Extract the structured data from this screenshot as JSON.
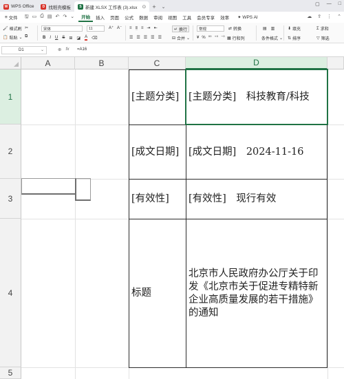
{
  "tabs": [
    {
      "label": "WPS Office",
      "logo": "W",
      "color": "#d8342a"
    },
    {
      "label": "找稻壳模板",
      "logo": "D",
      "color": "#d8342a"
    },
    {
      "label": "新建 XLSX 工作表 (3).xlsx",
      "logo": "S",
      "color": "#1f7244",
      "active": true
    }
  ],
  "menu": {
    "file": "文件",
    "items": [
      "开始",
      "插入",
      "页面",
      "公式",
      "数据",
      "审阅",
      "视图",
      "工具",
      "会员专享",
      "效率"
    ],
    "active": "开始",
    "ai": "WPS AI"
  },
  "ribbon": {
    "format_painter": "格式刷",
    "paste": "粘贴",
    "font_name": "宋体",
    "font_size": "11",
    "wrap": "换行",
    "number_format": "常规",
    "convert": "转换",
    "merge": "合并",
    "rows_cols": "行和列",
    "cond_format": "条件格式",
    "fill": "填充",
    "sort": "排序",
    "sum": "求和",
    "filter": "筛选",
    "bold": "B",
    "italic": "I",
    "underline": "U",
    "strike": "S",
    "font_color": "A"
  },
  "formula_bar": {
    "cell_ref": "D1",
    "fx": "fx",
    "formula": "=A16"
  },
  "columns": [
    "A",
    "B",
    "C",
    "D"
  ],
  "selected_column": "D",
  "rows": [
    "1",
    "2",
    "3",
    "4",
    "5"
  ],
  "selected_row": "1",
  "cells": {
    "C1": "[主题分类]",
    "D1": "[主题分类]　科技教育/科技",
    "C2": "[成文日期]",
    "D2": "[成文日期]　2024-11-16",
    "C3": "[有效性]",
    "D3": "[有效性]　现行有效",
    "C4": "标题",
    "D4": "北京市人民政府办公厅关于印发《北京市关于促进专精特新企业高质量发展的若干措施》的通知"
  },
  "colors": {
    "accent": "#1f7244",
    "header_bg": "#f2f2f2",
    "selected_header_bg": "#dcefe1"
  }
}
